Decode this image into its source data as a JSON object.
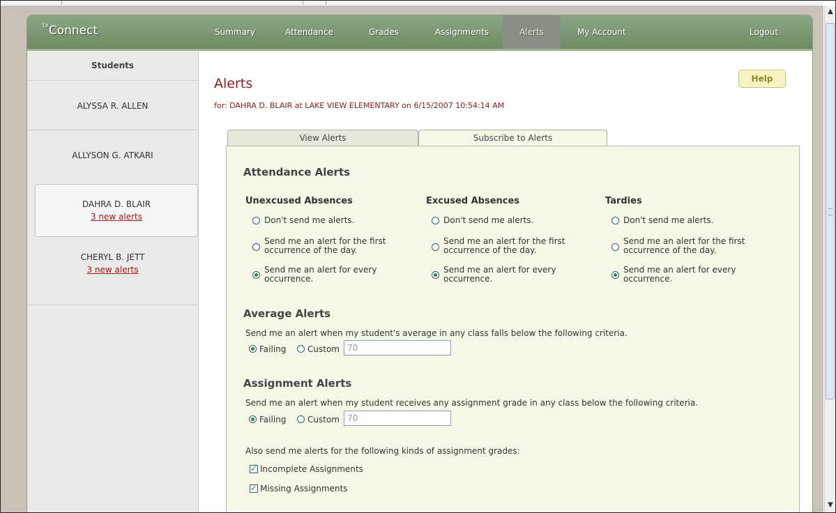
{
  "app": {
    "logo_prefix": "tx",
    "logo_text": "Connect"
  },
  "nav": {
    "items": [
      "Summary",
      "Attendance",
      "Grades",
      "Assignments",
      "Alerts",
      "My Account"
    ],
    "logout": "Logout",
    "active": "Alerts"
  },
  "sidebar": {
    "title": "Students",
    "students": [
      {
        "name": "ALYSSA R. ALLEN",
        "alerts": ""
      },
      {
        "name": "ALLYSON G. ATKARI",
        "alerts": ""
      },
      {
        "name": "DAHRA D. BLAIR",
        "alerts": "3 new alerts"
      },
      {
        "name": "CHERYL B. JETT",
        "alerts": "3 new alerts"
      }
    ]
  },
  "page": {
    "title": "Alerts",
    "subtitle": "for: DAHRA D. BLAIR at LAKE VIEW ELEMENTARY on 6/15/2007 10:54:14 AM",
    "help": "Help"
  },
  "tabs": {
    "view": "View Alerts",
    "subscribe": "Subscribe to Alerts"
  },
  "attendance": {
    "heading": "Attendance Alerts",
    "columns": [
      {
        "title": "Unexcused Absences"
      },
      {
        "title": "Excused Absences"
      },
      {
        "title": "Tardies"
      }
    ],
    "options": [
      {
        "line1": "Don't send me alerts.",
        "line2": ""
      },
      {
        "line1": "Send me an alert for the first",
        "line2": "occurrence of the day."
      },
      {
        "line1": "Send me an alert for every",
        "line2": "occurrence."
      }
    ],
    "selected_option_index": 2
  },
  "average": {
    "heading": "Average Alerts",
    "description": "Send me an alert when my student's average in any class falls below the following criteria.",
    "failing_label": "Failing",
    "custom_label": "Custom",
    "custom_value": "70",
    "selected": "Failing"
  },
  "assignment": {
    "heading": "Assignment Alerts",
    "description": "Send me an alert when my student receives any assignment grade in any class below the following criteria.",
    "failing_label": "Failing",
    "custom_label": "Custom",
    "custom_value": "70",
    "selected": "Failing",
    "also_text": "Also send me alerts for the following kinds of assignment grades:",
    "incomplete_label": "Incomplete Assignments",
    "missing_label": "Missing Assignments",
    "incomplete_checked": true,
    "missing_checked": true
  }
}
